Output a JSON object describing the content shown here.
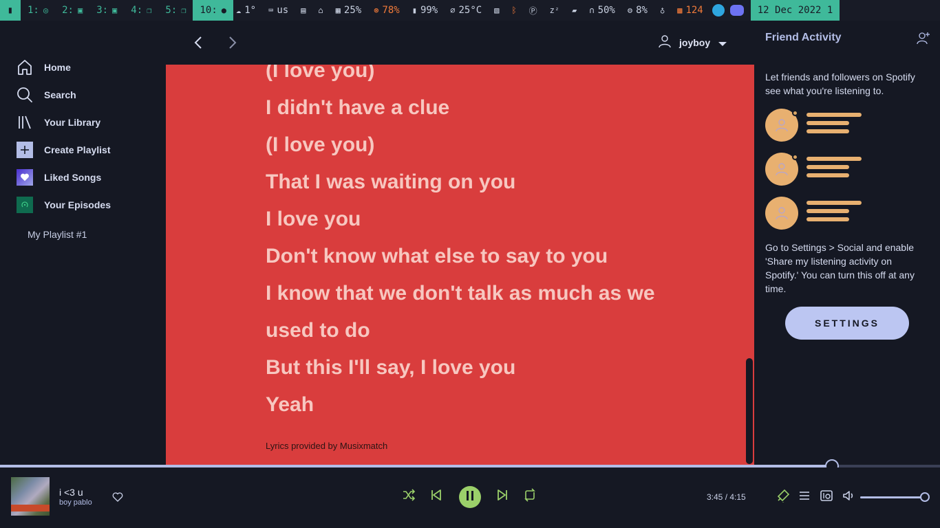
{
  "topbar": {
    "workspaces": [
      {
        "label": "1:",
        "icon": "chrome-icon"
      },
      {
        "label": "2:",
        "icon": "terminal-icon"
      },
      {
        "label": "3:",
        "icon": "terminal-icon"
      },
      {
        "label": "4:",
        "icon": "windows-icon"
      },
      {
        "label": "5:",
        "icon": "windows-icon"
      },
      {
        "label": "10:",
        "icon": "spotify-icon",
        "active": true
      }
    ],
    "weather": "1°",
    "keyboard": "us",
    "memory": "25%",
    "cpu_temp": "78%",
    "battery": "99%",
    "temperature": "25°C",
    "headphones": "50%",
    "cpu": "8%",
    "updates": "124",
    "date": "12 Dec 2022 1"
  },
  "sidebar": {
    "items": [
      {
        "label": "Home",
        "icon": "home-icon"
      },
      {
        "label": "Search",
        "icon": "search-icon"
      },
      {
        "label": "Your Library",
        "icon": "library-icon"
      },
      {
        "label": "Create Playlist",
        "icon": "plus-icon"
      },
      {
        "label": "Liked Songs",
        "icon": "heart-icon"
      },
      {
        "label": "Your Episodes",
        "icon": "podcast-icon"
      }
    ],
    "playlists": [
      "My Playlist #1"
    ]
  },
  "header": {
    "username": "joyboy"
  },
  "lyrics": {
    "lines": [
      "(I love you)",
      "I didn't have a clue",
      "(I love you)",
      "That I was waiting on you",
      "I love you",
      "Don't know what else to say to you",
      "I know that we don't talk as much as we",
      "used to do",
      "But this I'll say, I love you",
      "Yeah"
    ],
    "credit": "Lyrics provided by Musixmatch"
  },
  "friends": {
    "title": "Friend Activity",
    "description": "Let friends and followers on Spotify see what you're listening to.",
    "help": "Go to Settings > Social and enable 'Share my listening activity on Spotify.' You can turn this off at any time.",
    "settings_label": "SETTINGS"
  },
  "player": {
    "title": "i <3 u",
    "artist": "boy pablo",
    "elapsed": "3:45",
    "duration": "4:15",
    "time_text": "3:45 / 4:15",
    "progress_fraction": 0.885,
    "volume_fraction": 1.0
  },
  "colors": {
    "background": "#151823",
    "lyrics_bg": "#d93d3d",
    "lyrics_text": "#f7c7c0",
    "accent": "#b3bde6",
    "play_green": "#9bd06a",
    "placeholder": "#e8b070",
    "topbar_accent": "#3fb99a"
  }
}
